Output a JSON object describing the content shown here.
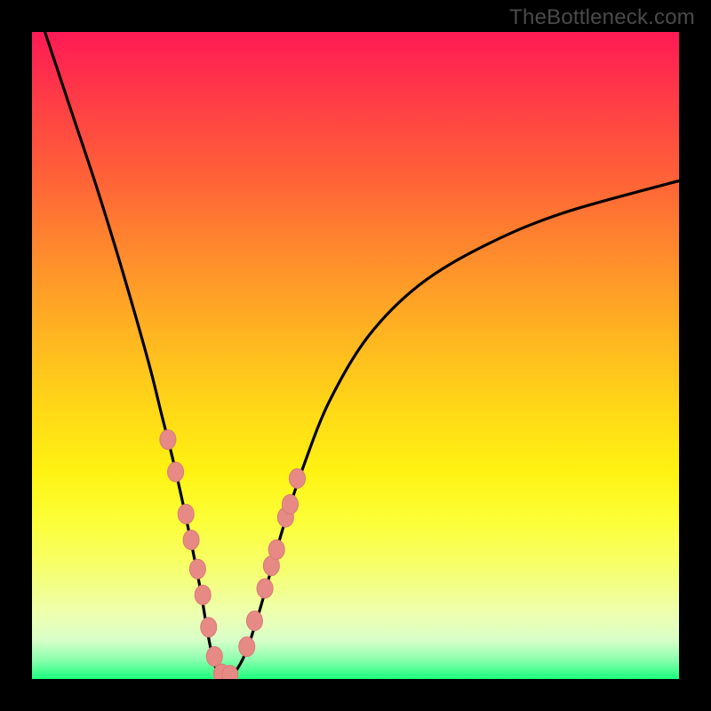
{
  "watermark": "TheBottleneck.com",
  "chart_data": {
    "type": "line",
    "title": "",
    "xlabel": "",
    "ylabel": "",
    "xlim": [
      0,
      100
    ],
    "ylim": [
      0,
      100
    ],
    "series": [
      {
        "name": "curve",
        "x": [
          2,
          6,
          10,
          14,
          18,
          20,
          22,
          24,
          26,
          27,
          28,
          29,
          30,
          31,
          33,
          35,
          37,
          39,
          42,
          46,
          52,
          60,
          70,
          82,
          100
        ],
        "y": [
          100,
          88,
          76,
          63,
          49,
          41,
          33,
          24,
          14,
          8,
          3,
          0.5,
          0,
          0.5,
          4,
          10,
          17,
          24,
          33,
          43,
          53,
          61,
          67,
          72,
          77
        ]
      }
    ],
    "markers": {
      "name": "dots",
      "x": [
        21.0,
        22.2,
        23.8,
        24.6,
        25.6,
        26.4,
        27.3,
        28.2,
        29.3,
        30.6,
        33.2,
        34.4,
        36.0,
        37.0,
        37.8,
        39.2,
        39.9,
        41.0
      ],
      "y": [
        37.0,
        32.0,
        25.5,
        21.5,
        17.0,
        13.0,
        8.0,
        3.5,
        0.8,
        0.6,
        5.0,
        9.0,
        14.0,
        17.5,
        20.0,
        25.0,
        27.0,
        31.0
      ]
    },
    "style": {
      "curve_stroke": "#000000",
      "curve_width": 3.2,
      "marker_fill": "#e78a86",
      "marker_stroke": "#d77a76",
      "marker_rx": 9,
      "marker_ry": 11
    }
  }
}
